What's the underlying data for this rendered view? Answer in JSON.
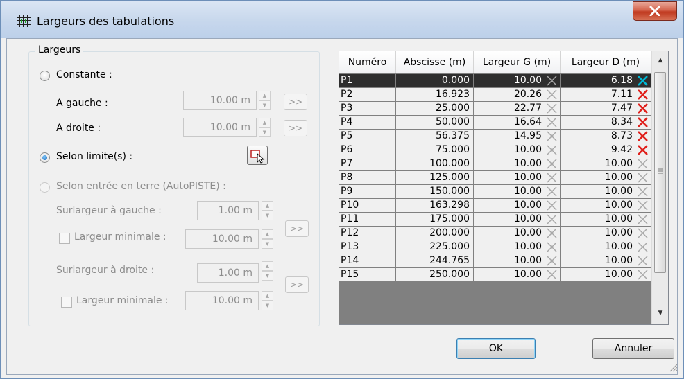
{
  "window": {
    "title": "Largeurs des tabulations",
    "close_label": "X"
  },
  "group": {
    "legend": "Largeurs",
    "constante_label": "Constante :",
    "a_gauche_label": "A gauche :",
    "a_gauche_value": "10.00 m",
    "a_droite_label": "A droite :",
    "a_droite_value": "10.00 m",
    "selon_limites_label": "Selon limite(s) :",
    "selon_entree_label": "Selon entrée en terre (AutoPISTE) :",
    "surlargeur_gauche_label": "Surlargeur à gauche :",
    "surlargeur_gauche_value": "1.00 m",
    "largeur_min_gauche_label": "Largeur minimale :",
    "largeur_min_gauche_value": "10.00 m",
    "surlargeur_droite_label": "Surlargeur à droite :",
    "surlargeur_droite_value": "1.00 m",
    "largeur_min_droite_label": "Largeur minimale :",
    "largeur_min_droite_value": "10.00 m",
    "arrow_label": ">>",
    "selected_radio": "selon_limites"
  },
  "table": {
    "headers": [
      "Numéro",
      "Abscisse (m)",
      "Largeur G (m)",
      "Largeur D (m)"
    ],
    "rows": [
      {
        "num": "P1",
        "abs": "0.000",
        "lg": "10.00",
        "ld": "6.18",
        "ld_icon": "cyan"
      },
      {
        "num": "P2",
        "abs": "16.923",
        "lg": "20.26",
        "ld": "7.11",
        "ld_icon": "red"
      },
      {
        "num": "P3",
        "abs": "25.000",
        "lg": "22.77",
        "ld": "7.47",
        "ld_icon": "red"
      },
      {
        "num": "P4",
        "abs": "50.000",
        "lg": "16.64",
        "ld": "8.34",
        "ld_icon": "red"
      },
      {
        "num": "P5",
        "abs": "56.375",
        "lg": "14.95",
        "ld": "8.73",
        "ld_icon": "red"
      },
      {
        "num": "P6",
        "abs": "75.000",
        "lg": "10.00",
        "ld": "9.42",
        "ld_icon": "red"
      },
      {
        "num": "P7",
        "abs": "100.000",
        "lg": "10.00",
        "ld": "10.00",
        "ld_icon": "grey"
      },
      {
        "num": "P8",
        "abs": "125.000",
        "lg": "10.00",
        "ld": "10.00",
        "ld_icon": "grey"
      },
      {
        "num": "P9",
        "abs": "150.000",
        "lg": "10.00",
        "ld": "10.00",
        "ld_icon": "grey"
      },
      {
        "num": "P10",
        "abs": "163.298",
        "lg": "10.00",
        "ld": "10.00",
        "ld_icon": "grey"
      },
      {
        "num": "P11",
        "abs": "175.000",
        "lg": "10.00",
        "ld": "10.00",
        "ld_icon": "grey"
      },
      {
        "num": "P12",
        "abs": "200.000",
        "lg": "10.00",
        "ld": "10.00",
        "ld_icon": "grey"
      },
      {
        "num": "P13",
        "abs": "225.000",
        "lg": "10.00",
        "ld": "10.00",
        "ld_icon": "grey"
      },
      {
        "num": "P14",
        "abs": "244.765",
        "lg": "10.00",
        "ld": "10.00",
        "ld_icon": "grey"
      },
      {
        "num": "P15",
        "abs": "250.000",
        "lg": "10.00",
        "ld": "10.00",
        "ld_icon": "grey"
      }
    ],
    "selected_row": 0,
    "icon_colors": {
      "cyan": "#00b8d4",
      "red": "#e0201c",
      "grey": "#a8a8a8"
    }
  },
  "buttons": {
    "ok": "OK",
    "cancel": "Annuler"
  }
}
